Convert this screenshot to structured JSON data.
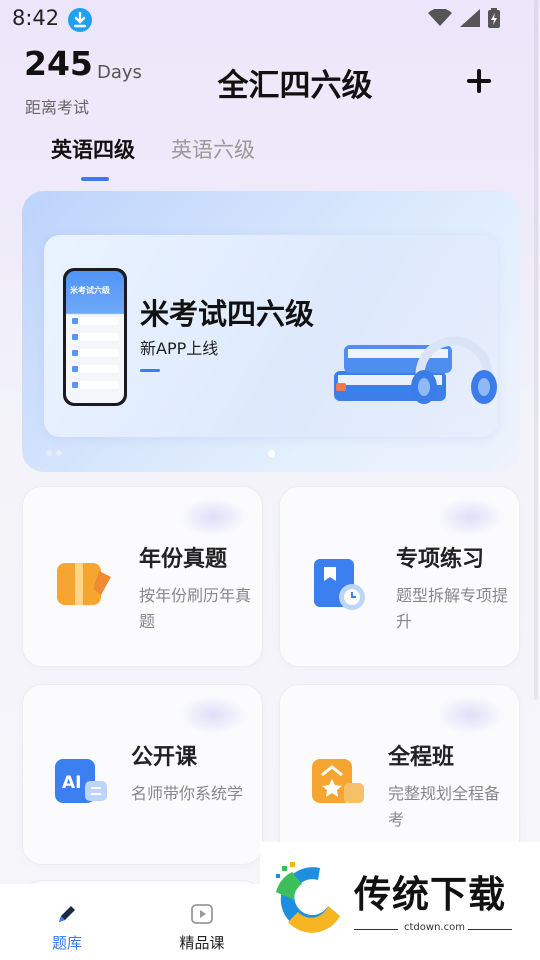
{
  "status_bar": {
    "time": "8:42"
  },
  "header": {
    "days_number": "245",
    "days_unit": "Days",
    "countdown_label": "距离考试",
    "title": "全汇四六级"
  },
  "tabs": [
    {
      "label": "英语四级",
      "active": true
    },
    {
      "label": "英语六级",
      "active": false
    }
  ],
  "banner": {
    "phone_title": "米考试六级",
    "headline": "米考试四六级",
    "subline": "新APP上线",
    "page_count": 2,
    "active_page": 1
  },
  "features": [
    {
      "title": "年份真题",
      "desc": "按年份刷历年真题",
      "icon": "book-bookmark-icon"
    },
    {
      "title": "专项练习",
      "desc": "题型拆解专项提升",
      "icon": "timer-book-icon"
    },
    {
      "title": "公开课",
      "desc": "名师带你系统学",
      "icon": "ai-course-icon"
    },
    {
      "title": "全程班",
      "desc": "完整规划全程备考",
      "icon": "star-class-icon"
    }
  ],
  "bottom_nav": [
    {
      "label": "题库",
      "icon": "pencil-icon",
      "active": true
    },
    {
      "label": "精品课",
      "icon": "play-icon",
      "active": false
    }
  ],
  "watermark": {
    "text": "传统下载",
    "url": "ctdown.com"
  },
  "colors": {
    "accent": "#3a7cf6",
    "nav_active": "#3a7cf6",
    "muted": "#999999"
  }
}
